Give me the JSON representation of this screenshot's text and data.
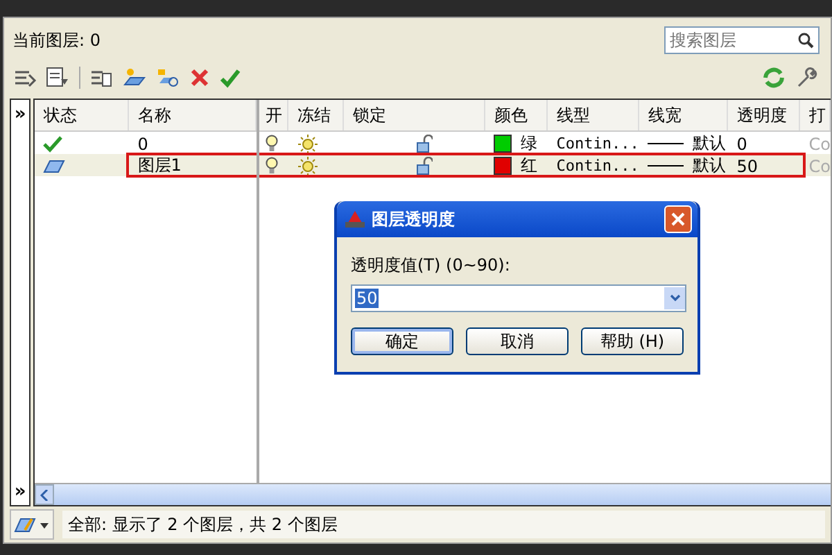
{
  "header": {
    "current_layer_label": "当前图层: 0",
    "search": {
      "placeholder": "搜索图层"
    }
  },
  "table": {
    "columns": [
      "状态",
      "名称",
      "开",
      "冻结",
      "锁定",
      "颜色",
      "线型",
      "线宽",
      "透明度",
      "打"
    ],
    "rows": [
      {
        "kind": "current",
        "name": "0",
        "on": true,
        "frozen": false,
        "locked": false,
        "color": "#00cc00",
        "color_name": "绿",
        "linetype": "Contin...",
        "lineweight": "默认",
        "transparency": "0",
        "column_10": "Co",
        "selected": false,
        "highlighted": false
      },
      {
        "kind": "layer",
        "name": "图层1",
        "on": true,
        "frozen": false,
        "locked": false,
        "color": "#e00000",
        "color_name": "红",
        "linetype": "Contin...",
        "lineweight": "默认",
        "transparency": "50",
        "column_10": "Co",
        "selected": true,
        "highlighted": true
      }
    ]
  },
  "expand_button": "»",
  "status_bar": "全部: 显示了 2 个图层，共 2 个图层",
  "dialog": {
    "title": "图层透明度",
    "label": "透明度值(T)  (0~90):",
    "value": "50",
    "buttons": [
      {
        "label": "确定",
        "default": true
      },
      {
        "label": "取消",
        "default": false
      },
      {
        "label": "帮助 (H)",
        "default": false
      }
    ]
  }
}
